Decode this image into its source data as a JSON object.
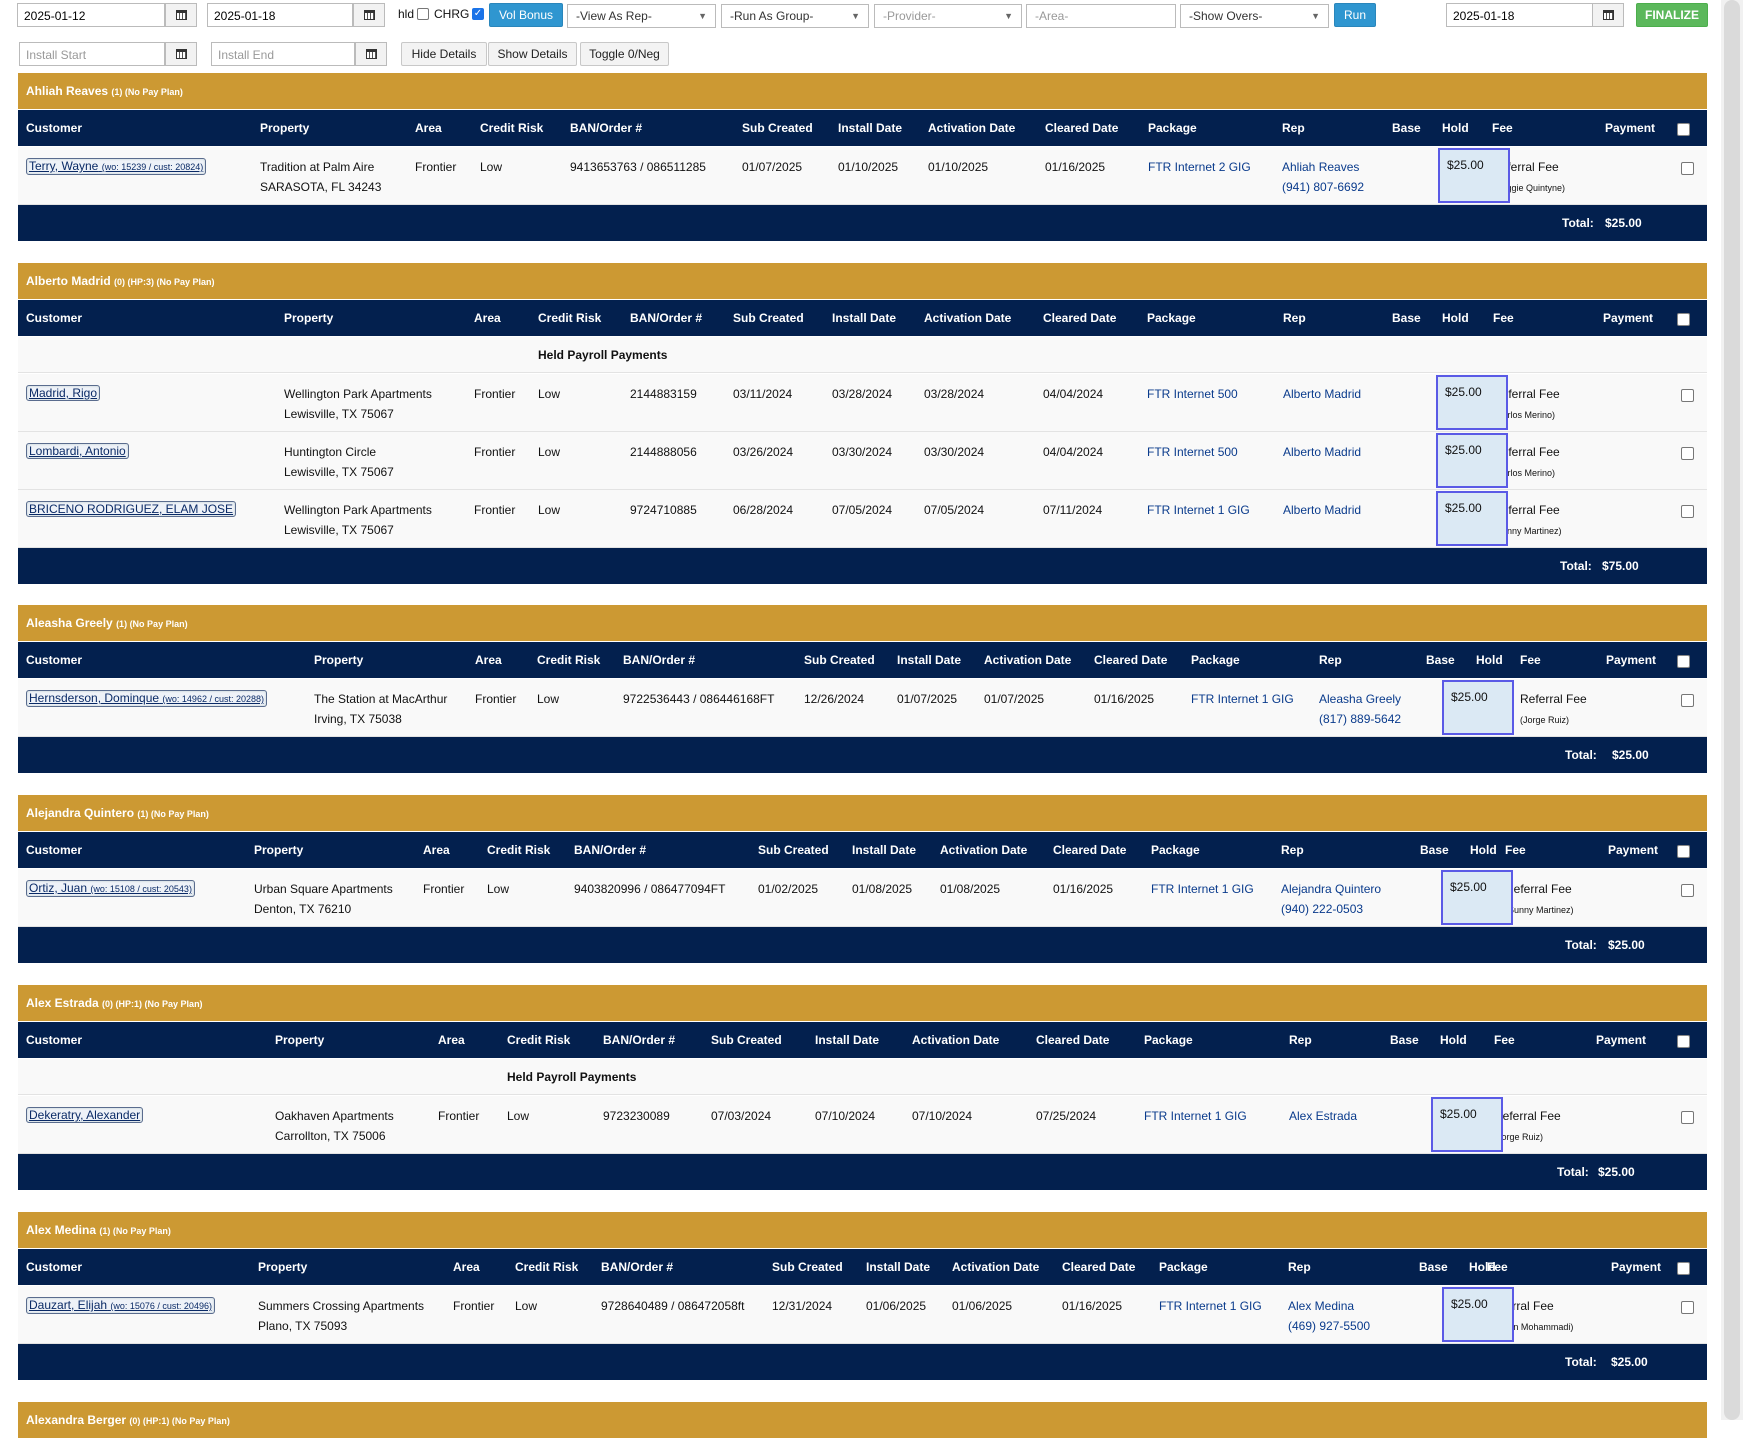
{
  "toolbar": {
    "date_from": "2025-01-12",
    "date_to": "2025-01-18",
    "hld_label": "hld",
    "chrg_label": "CHRG",
    "vol_bonus_label": "Vol Bonus",
    "view_as_rep": "-View As Rep-",
    "run_as_group": "-Run As Group-",
    "provider": "-Provider-",
    "area_placeholder": "-Area-",
    "show_overs": "-Show Overs-",
    "run_label": "Run",
    "finalize_date": "2025-01-18",
    "finalize_label": "FINALIZE",
    "install_start_placeholder": "Install Start",
    "install_end_placeholder": "Install End",
    "hide_details": "Hide Details",
    "show_details": "Show Details",
    "toggle_neg": "Toggle 0/Neg"
  },
  "columns": {
    "customer": "Customer",
    "property": "Property",
    "area": "Area",
    "credit_risk": "Credit Risk",
    "ban": "BAN/Order #",
    "sub_created": "Sub Created",
    "install_date": "Install Date",
    "activation_date": "Activation Date",
    "cleared_date": "Cleared Date",
    "package": "Package",
    "rep": "Rep",
    "base": "Base",
    "hold": "Hold",
    "fee": "Fee",
    "payment": "Payment"
  },
  "held_label": "Held Payroll Payments",
  "total_label": "Total:",
  "groups": [
    {
      "name": "Ahliah Reaves",
      "meta": "(1) (No Pay Plan)",
      "total": "$25.00",
      "rows": [
        {
          "customer": "Terry, Wayne",
          "customer_ids": "(wo: 15239 / cust: 20824)",
          "property": "Tradition at Palm Aire",
          "address": "SARASOTA, FL 34243",
          "area": "Frontier",
          "credit": "Low",
          "ban": "9413653763 / 086511285",
          "sub": "01/07/2025",
          "install": "01/10/2025",
          "activation": "01/10/2025",
          "cleared": "01/16/2025",
          "package": "FTR Internet 2 GIG",
          "rep": "Ahliah Reaves",
          "rep_phone": "(941) 807-6692",
          "fee": "Referral Fee",
          "fee_by": "(Reggie Quintyne)",
          "payment": "$25.00"
        }
      ]
    },
    {
      "name": "Alberto Madrid",
      "meta": "(0) (HP:3) (No Pay Plan)",
      "total": "$75.00",
      "rows": [
        {
          "customer": "Madrid, Rigo",
          "customer_ids": "",
          "property": "Wellington Park Apartments",
          "address": "Lewisville, TX 75067",
          "area": "Frontier",
          "credit": "Low",
          "ban": "2144883159",
          "sub": "03/11/2024",
          "install": "03/28/2024",
          "activation": "03/28/2024",
          "cleared": "04/04/2024",
          "package": "FTR Internet 500",
          "rep": "Alberto Madrid",
          "rep_phone": "",
          "fee": "Referral Fee",
          "fee_by": "(Carlos Merino)",
          "payment": "$25.00"
        },
        {
          "customer": "Lombardi, Antonio",
          "customer_ids": "",
          "property": "Huntington Circle",
          "address": "Lewisville, TX 75067",
          "area": "Frontier",
          "credit": "Low",
          "ban": "2144888056",
          "sub": "03/26/2024",
          "install": "03/30/2024",
          "activation": "03/30/2024",
          "cleared": "04/04/2024",
          "package": "FTR Internet 500",
          "rep": "Alberto Madrid",
          "rep_phone": "",
          "fee": "Referral Fee",
          "fee_by": "(Carlos Merino)",
          "payment": "$25.00"
        },
        {
          "customer": "BRICENO RODRIGUEZ, ELAM JOSE",
          "customer_ids": "",
          "property": "Wellington Park Apartments",
          "address": "Lewisville, TX 75067",
          "area": "Frontier",
          "credit": "Low",
          "ban": "9724710885",
          "sub": "06/28/2024",
          "install": "07/05/2024",
          "activation": "07/05/2024",
          "cleared": "07/11/2024",
          "package": "FTR Internet 1 GIG",
          "rep": "Alberto Madrid",
          "rep_phone": "",
          "fee": "Referral Fee",
          "fee_by": "(Sunny Martinez)",
          "payment": "$25.00"
        }
      ]
    },
    {
      "name": "Aleasha Greely",
      "meta": "(1) (No Pay Plan)",
      "total": "$25.00",
      "rows": [
        {
          "customer": "Hernsderson, Dominque",
          "customer_ids": "(wo: 14962 / cust: 20288)",
          "property": "The Station at MacArthur",
          "address": "Irving, TX 75038",
          "area": "Frontier",
          "credit": "Low",
          "ban": "9722536443 / 086446168FT",
          "sub": "12/26/2024",
          "install": "01/07/2025",
          "activation": "01/07/2025",
          "cleared": "01/16/2025",
          "package": "FTR Internet 1 GIG",
          "rep": "Aleasha Greely",
          "rep_phone": "(817) 889-5642",
          "fee": "Referral Fee",
          "fee_by": "(Jorge Ruiz)",
          "payment": "$25.00"
        }
      ]
    },
    {
      "name": "Alejandra Quintero",
      "meta": "(1) (No Pay Plan)",
      "total": "$25.00",
      "rows": [
        {
          "customer": "Ortiz, Juan",
          "customer_ids": "(wo: 15108 / cust: 20543)",
          "property": "Urban Square Apartments",
          "address": "Denton, TX 76210",
          "area": "Frontier",
          "credit": "Low",
          "ban": "9403820996 / 086477094FT",
          "sub": "01/02/2025",
          "install": "01/08/2025",
          "activation": "01/08/2025",
          "cleared": "01/16/2025",
          "package": "FTR Internet 1 GIG",
          "rep": "Alejandra Quintero",
          "rep_phone": "(940) 222-0503",
          "fee": "Referral Fee",
          "fee_by": "(Sunny Martinez)",
          "payment": "$25.00"
        }
      ]
    },
    {
      "name": "Alex Estrada",
      "meta": "(0) (HP:1) (No Pay Plan)",
      "total": "$25.00",
      "rows": [
        {
          "customer": "Dekeratry, Alexander",
          "customer_ids": "",
          "property": "Oakhaven Apartments",
          "address": "Carrollton, TX 75006",
          "area": "Frontier",
          "credit": "Low",
          "ban": "9723230089",
          "sub": "07/03/2024",
          "install": "07/10/2024",
          "activation": "07/10/2024",
          "cleared": "07/25/2024",
          "package": "FTR Internet 1 GIG",
          "rep": "Alex Estrada",
          "rep_phone": "",
          "fee": "Referral Fee",
          "fee_by": "(Jorge Ruiz)",
          "payment": "$25.00"
        }
      ]
    },
    {
      "name": "Alex Medina",
      "meta": "(1) (No Pay Plan)",
      "total": "$25.00",
      "rows": [
        {
          "customer": "Dauzart, Elijah",
          "customer_ids": "(wo: 15076 / cust: 20496)",
          "property": "Summers Crossing Apartments",
          "address": "Plano, TX 75093",
          "area": "Frontier",
          "credit": "Low",
          "ban": "9728640489 / 086472058ft",
          "sub": "12/31/2024",
          "install": "01/06/2025",
          "activation": "01/06/2025",
          "cleared": "01/16/2025",
          "package": "FTR Internet 1 GIG",
          "rep": "Alex Medina",
          "rep_phone": "(469) 927-5500",
          "fee": "Referral Fee",
          "fee_by": "(Steffan Mohammadi)",
          "payment": "$25.00"
        }
      ]
    },
    {
      "name": "Alexandra Berger",
      "meta": "(0) (HP:1) (No Pay Plan)",
      "total": "",
      "rows": []
    }
  ]
}
